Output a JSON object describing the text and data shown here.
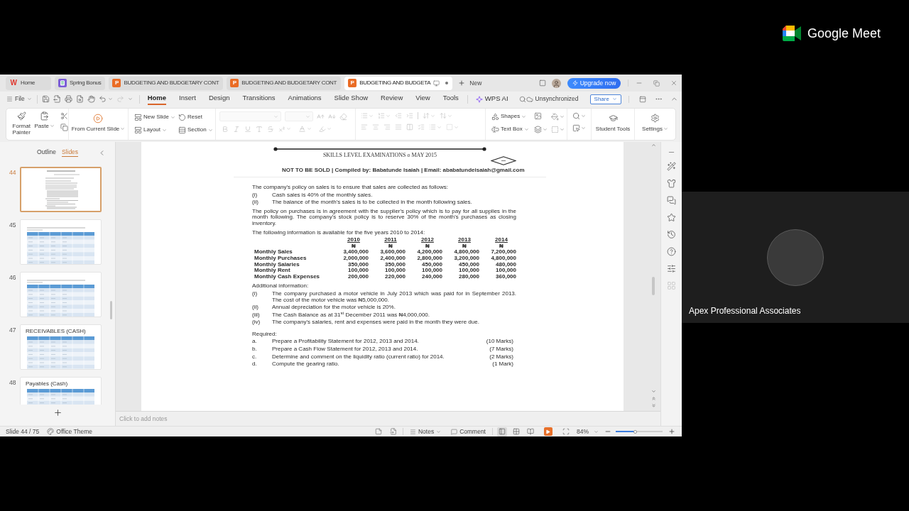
{
  "meet": {
    "brand": "Google Meet",
    "participant": {
      "name": "Apex Professional Associates"
    }
  },
  "tabs": [
    {
      "label": "Home",
      "kind": "writer",
      "badge": "W",
      "selected": false,
      "unsaved": false
    },
    {
      "label": "Spring Bonus",
      "kind": "form",
      "selected": false,
      "unsaved": false
    },
    {
      "label": "BUDGETING AND BUDGETARY CONT",
      "kind": "presentation",
      "badge": "P",
      "selected": false,
      "unsaved": false
    },
    {
      "label": "BUDGETING AND BUDGETARY CONT",
      "kind": "presentation",
      "badge": "P",
      "selected": false,
      "unsaved": false
    },
    {
      "label": "BUDGETING AND BUDGETA",
      "kind": "presentation",
      "badge": "P",
      "selected": true,
      "unsaved": true
    }
  ],
  "title_bar": {
    "new_tab": "New",
    "upgrade": "Upgrade now"
  },
  "menu": {
    "file": "File",
    "tabs": [
      {
        "label": "Home",
        "selected": true
      },
      {
        "label": "Insert",
        "selected": false
      },
      {
        "label": "Design",
        "selected": false
      },
      {
        "label": "Transitions",
        "selected": false
      },
      {
        "label": "Animations",
        "selected": false
      },
      {
        "label": "Slide Show",
        "selected": false
      },
      {
        "label": "Review",
        "selected": false
      },
      {
        "label": "View",
        "selected": false
      },
      {
        "label": "Tools",
        "selected": false
      }
    ],
    "ai": "WPS AI",
    "sync": "Unsynchronized",
    "share": "Share"
  },
  "ribbon": {
    "format_painter": "Format Painter",
    "paste": "Paste",
    "from_current_slide": "From Current Slide",
    "new_slide": "New Slide",
    "reset": "Reset",
    "layout": "Layout",
    "section": "Section",
    "font_group": {
      "disabled": true
    },
    "paragraph_group": {
      "disabled": true
    },
    "shapes": "Shapes",
    "text_box": "Text Box",
    "student_tools": "Student Tools",
    "settings": "Settings"
  },
  "slides_panel": {
    "tabs": [
      {
        "label": "Outline",
        "selected": false
      },
      {
        "label": "Slides",
        "selected": true
      }
    ],
    "thumbnails": [
      {
        "number": "44",
        "kind": "document",
        "selected": true
      },
      {
        "number": "45",
        "kind": "table",
        "selected": false
      },
      {
        "number": "46",
        "kind": "table",
        "selected": false
      },
      {
        "number": "47",
        "kind": "table",
        "title": "RECEIVABLES (CASH)",
        "selected": false
      },
      {
        "number": "48",
        "kind": "table",
        "title": "Payables (Cash)",
        "selected": false
      }
    ]
  },
  "slide": {
    "header": "SKILLS LEVEL EXAMINATIONS o MAY 2015",
    "notice": "NOT TO BE SOLD | Compiled by: Babatunde Isaiah | Email: ababatundeisaiah@gmail.com",
    "intro": "The company's policy on sales is to ensure that sales are collected as follows:",
    "sales_policy": [
      {
        "marker": "(i)",
        "text": "Cash sales is 40% of the monthly sales."
      },
      {
        "marker": "(ii)",
        "text": "The balance of the month's sales is to be collected in the month following sales."
      }
    ],
    "purchases": "The policy on purchases is in agreement with the supplier's policy which is to pay for all supplies in the month following.  The company's stock policy is to reserve 30% of the month's purchases as closing inventory.",
    "table_intro": "The following information is available for the five years 2010 to 2014:",
    "table": {
      "columns": [
        {
          "year": "2010",
          "unit": "₦"
        },
        {
          "year": "2011",
          "unit": "₦"
        },
        {
          "year": "2012",
          "unit": "₦"
        },
        {
          "year": "2013",
          "unit": "₦"
        },
        {
          "year": "2014",
          "unit": "₦"
        }
      ],
      "rows": [
        {
          "label": "Monthly Sales",
          "values": [
            "3,400,000",
            "3,600,000",
            "4,200,000",
            "4,800,000",
            "7,200,000"
          ]
        },
        {
          "label": "Monthly Purchases",
          "values": [
            "2,000,000",
            "2,400,000",
            "2,800,000",
            "3,200,000",
            "4,800,000"
          ]
        },
        {
          "label": "Monthly Salaries",
          "values": [
            "350,000",
            "350,000",
            "450,000",
            "450,000",
            "480,000"
          ]
        },
        {
          "label": "Monthly Rent",
          "values": [
            "100,000",
            "100,000",
            "100,000",
            "100,000",
            "100,000"
          ]
        },
        {
          "label": "Monthly Cash Expenses",
          "values": [
            "200,000",
            "220,000",
            "240,000",
            "280,000",
            "360,000"
          ]
        }
      ]
    },
    "additional_heading": "Additional information:",
    "additional": [
      {
        "marker": "(i)",
        "text": "The company purchased a motor vehicle in July 2013 which was paid for in September 2013.  The cost of the motor vehicle was ₦5,000,000."
      },
      {
        "marker": "(ii)",
        "text": "Annual depreciation for the motor vehicle is 20%."
      },
      {
        "marker": "(iii)",
        "text": "The Cash Balance as at 31$^{st}$ December 2011 was ₦4,000,000."
      },
      {
        "marker": "(iv)",
        "text": "The company's salaries, rent and expenses were paid in the month they were due."
      }
    ],
    "required_heading": "Required:",
    "required": [
      {
        "marker": "a.",
        "text": "Prepare a Profitability Statement for 2012, 2013 and 2014.",
        "marks": "(10 Marks)"
      },
      {
        "marker": "b.",
        "text": "Prepare a Cash Flow Statement for 2012, 2013 and 2014.",
        "marks": "(7 Marks)"
      },
      {
        "marker": "c.",
        "text": "Determine and comment on the liquidity ratio (current ratio) for 2014.",
        "marks": "(2 Marks)"
      },
      {
        "marker": "d.",
        "text": "Compute the gearing ratio.",
        "marks": "(1 Mark)"
      }
    ]
  },
  "notes": {
    "placeholder": "Click to add notes"
  },
  "status_bar": {
    "slide": "Slide 44 / 75",
    "theme": "Office Theme",
    "notes": "Notes",
    "comment": "Comment",
    "views": [
      {
        "kind": "normal",
        "selected": true
      },
      {
        "kind": "sorter",
        "selected": false
      },
      {
        "kind": "reading",
        "selected": false
      }
    ],
    "zoom": "84%",
    "zoom_slider": {
      "level": 0.42
    }
  }
}
